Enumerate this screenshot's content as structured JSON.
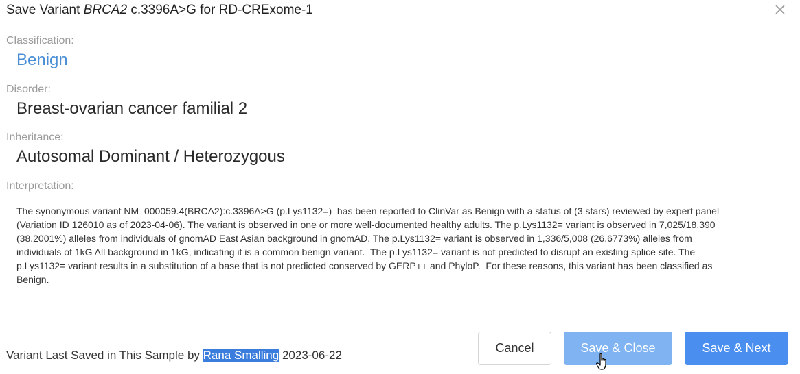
{
  "dialog": {
    "title_prefix": "Save Variant",
    "gene": "BRCA2",
    "title_suffix": "c.3396A>G for RD-CRExome-1",
    "close_icon": "close-icon"
  },
  "classification": {
    "label": "Classification:",
    "value": "Benign",
    "value_color": "#4a8fd6"
  },
  "disorder": {
    "label": "Disorder:",
    "value": "Breast-ovarian cancer familial 2"
  },
  "inheritance": {
    "label": "Inheritance:",
    "value": "Autosomal Dominant / Heterozygous"
  },
  "interpretation": {
    "label": "Interpretation:",
    "text": "The synonymous variant NM_000059.4(BRCA2):c.3396A>G (p.Lys1132=)  has been reported to ClinVar as Benign with a status of (3 stars) reviewed by expert panel\n(Variation ID 126010 as of 2023-04-06). The variant is observed in one or more well-documented healthy adults. The p.Lys1132= variant is observed in 7,025/18,390\n(38.2001%) alleles from individuals of gnomAD East Asian background in gnomAD. The p.Lys1132= variant is observed in 1,336/5,008 (26.6773%) alleles from\nindividuals of 1kG All background in 1kG, indicating it is a common benign variant.  The p.Lys1132= variant is not predicted to disrupt an existing splice site. The\np.Lys1132= variant results in a substitution of a base that is not predicted conserved by GERP++ and PhyloP.  For these reasons, this variant has been classified as\nBenign."
  },
  "footer": {
    "status_prefix": "Variant Last Saved in This Sample by",
    "user": "Rana Smalling",
    "date": "2023-06-22"
  },
  "buttons": {
    "cancel": "Cancel",
    "save_close": "Save & Close",
    "save_next": "Save & Next"
  },
  "colors": {
    "primary": "#4a8ff0",
    "primary_hover": "#7fb3f1",
    "selection_highlight": "#3b7ddd"
  },
  "cursor_icon": "hand-pointer-icon"
}
